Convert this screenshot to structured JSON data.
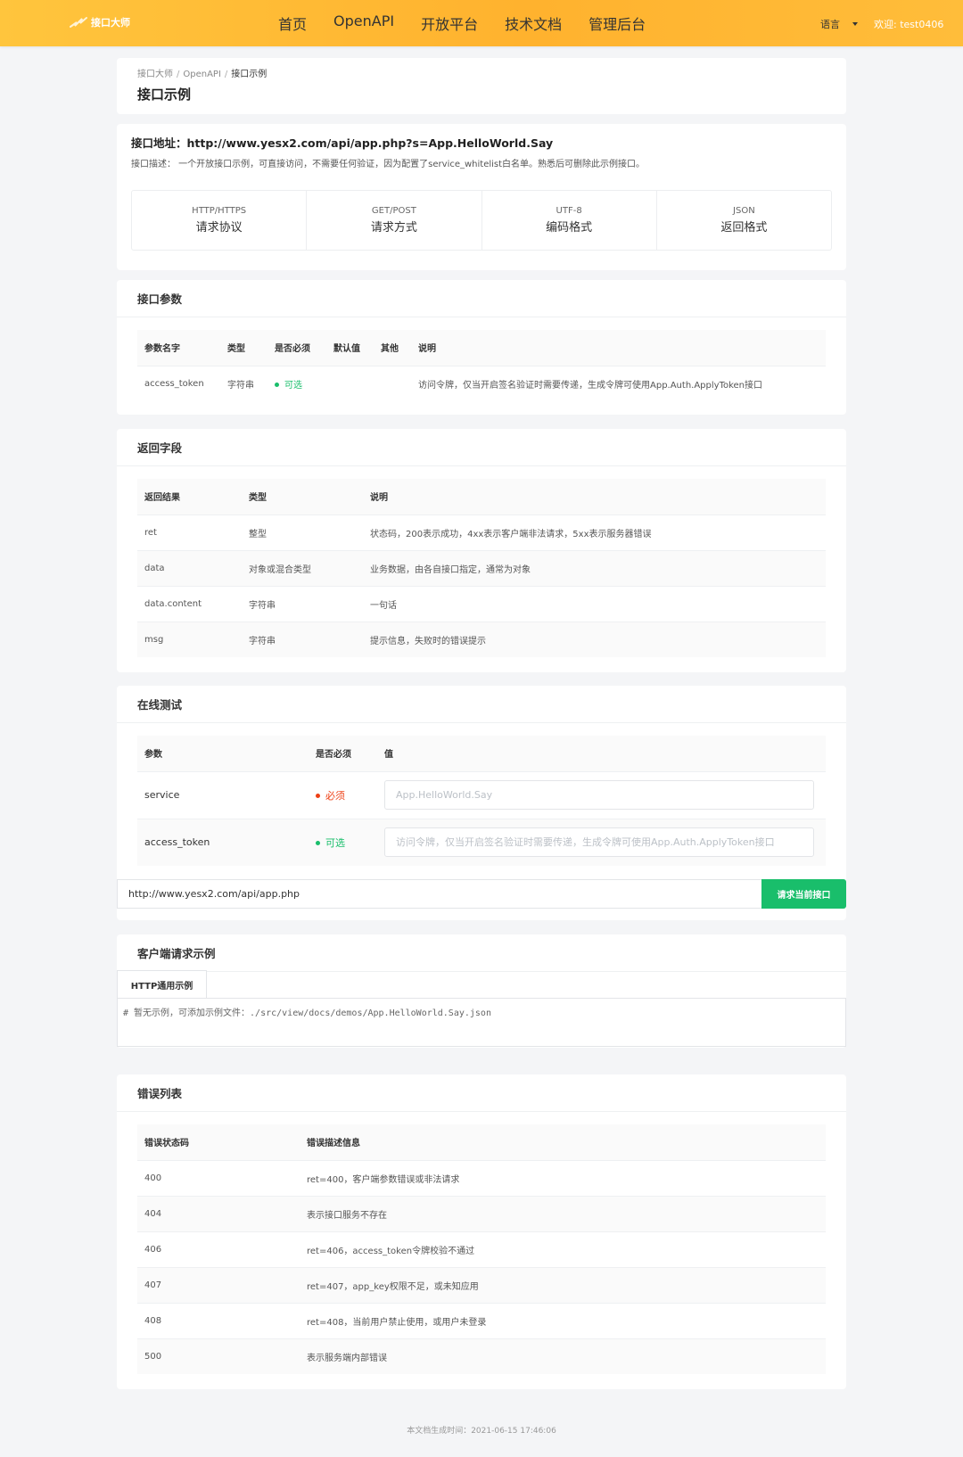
{
  "header": {
    "logo_text": "接口大师",
    "nav": [
      "首页",
      "OpenAPI",
      "开放平台",
      "技术文档",
      "管理后台"
    ],
    "language": "语言",
    "welcome": "欢迎: test0406",
    "accent": "#ffb22e"
  },
  "breadcrumb": [
    "接口大师",
    "OpenAPI",
    "接口示例"
  ],
  "page_title": "接口示例",
  "api": {
    "url_label": "接口地址：http://www.yesx2.com/api/app.php?s=App.HelloWorld.Say",
    "desc": "接口描述： 一个开放接口示例，可直接访问，不需要任何验证，因为配置了service_whitelist白名单。熟悉后可删除此示例接口。",
    "stats": [
      {
        "top": "HTTP/HTTPS",
        "bottom": "请求协议"
      },
      {
        "top": "GET/POST",
        "bottom": "请求方式"
      },
      {
        "top": "UTF-8",
        "bottom": "编码格式"
      },
      {
        "top": "JSON",
        "bottom": "返回格式"
      }
    ]
  },
  "params": {
    "title": "接口参数",
    "headers": [
      "参数名字",
      "类型",
      "是否必须",
      "默认值",
      "其他",
      "说明"
    ],
    "rows": [
      {
        "name": "access_token",
        "type": "字符串",
        "required": "可选",
        "default": "",
        "other": "",
        "desc": "访问令牌，仅当开启签名验证时需要传递，生成令牌可使用App.Auth.ApplyToken接口"
      }
    ]
  },
  "returns": {
    "title": "返回字段",
    "headers": [
      "返回结果",
      "类型",
      "说明"
    ],
    "rows": [
      {
        "name": "ret",
        "type": "整型",
        "desc": "状态码，200表示成功，4xx表示客户端非法请求，5xx表示服务器错误"
      },
      {
        "name": "data",
        "type": "对象或混合类型",
        "desc": "业务数据，由各自接口指定，通常为对象"
      },
      {
        "name": "data.content",
        "type": "字符串",
        "desc": "一句话"
      },
      {
        "name": "msg",
        "type": "字符串",
        "desc": "提示信息，失败时的错误提示"
      }
    ]
  },
  "test": {
    "title": "在线测试",
    "headers": [
      "参数",
      "是否必须",
      "值"
    ],
    "rows": [
      {
        "name": "service",
        "required": "必须",
        "placeholder": "App.HelloWorld.Say"
      },
      {
        "name": "access_token",
        "required": "可选",
        "placeholder": "访问令牌，仅当开启签名验证时需要传递，生成令牌可使用App.Auth.ApplyToken接口"
      }
    ],
    "request_url": "http://www.yesx2.com/api/app.php",
    "request_button": "请求当前接口",
    "button_color": "#19be6b"
  },
  "client": {
    "title": "客户端请求示例",
    "tab": "HTTP通用示例",
    "code": "# 暂无示例，可添加示例文件：./src/view/docs/demos/App.HelloWorld.Say.json"
  },
  "errors": {
    "title": "错误列表",
    "headers": [
      "错误状态码",
      "错误描述信息"
    ],
    "rows": [
      {
        "code": "400",
        "desc": "ret=400，客户端参数错误或非法请求"
      },
      {
        "code": "404",
        "desc": "表示接口服务不存在"
      },
      {
        "code": "406",
        "desc": "ret=406，access_token令牌校验不通过"
      },
      {
        "code": "407",
        "desc": "ret=407，app_key权限不足，或未知应用"
      },
      {
        "code": "408",
        "desc": "ret=408，当前用户禁止使用，或用户未登录"
      },
      {
        "code": "500",
        "desc": "表示服务端内部错误"
      }
    ]
  },
  "footer": "本文档生成时间：2021-06-15 17:46:06"
}
